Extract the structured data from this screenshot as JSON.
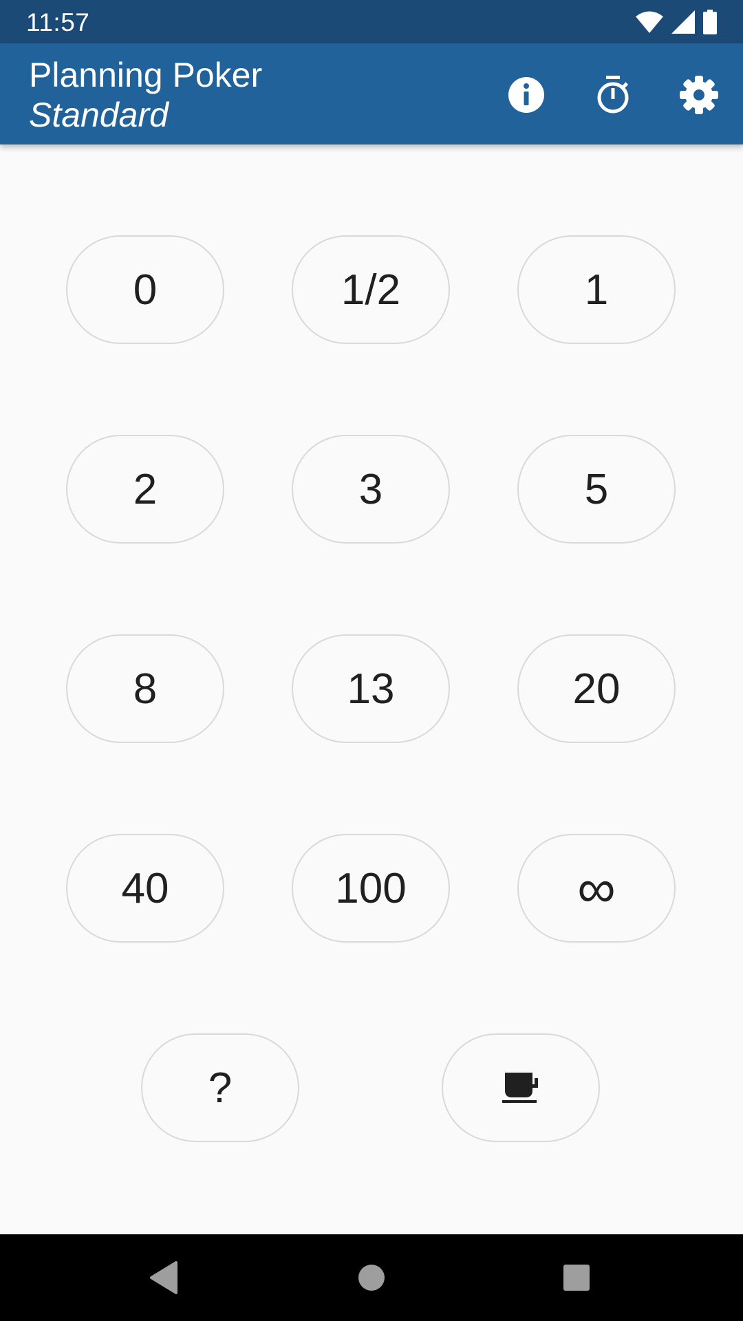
{
  "status_bar": {
    "time": "11:57"
  },
  "toolbar": {
    "title": "Planning Poker",
    "subtitle": "Standard",
    "actions": [
      "info-icon",
      "timer-icon",
      "settings-icon"
    ]
  },
  "deck": {
    "rows": [
      [
        "0",
        "1/2",
        "1"
      ],
      [
        "2",
        "3",
        "5"
      ],
      [
        "8",
        "13",
        "20"
      ],
      [
        "40",
        "100",
        "∞"
      ],
      [
        "?"
      ]
    ],
    "coffee_card_icon": "coffee-cup-icon"
  },
  "nav_bar": {
    "buttons": [
      "back-icon",
      "home-icon",
      "recents-icon"
    ]
  },
  "colors": {
    "status_bar": "#1b4a77",
    "toolbar": "#21629a",
    "background": "#fafafa",
    "card_border": "#d9d9d9",
    "card_text": "#202020"
  }
}
